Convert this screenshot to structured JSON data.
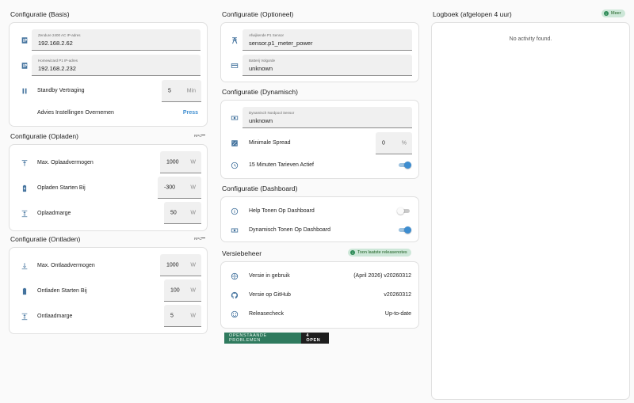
{
  "basis": {
    "title": "Configuratie (Basis)",
    "zendure_caption": "Zendure 2400 AC IP-adres",
    "zendure_value": "192.168.2.62",
    "homewizard_caption": "Homewizard P1 IP-adres",
    "homewizard_value": "192.168.2.232",
    "standby_label": "Standby Vertraging",
    "standby_value": "5",
    "standby_unit": "Min",
    "advies_label": "Advies Instellingen Overnemen",
    "press_label": "Press"
  },
  "opladen": {
    "title": "Configuratie (Opladen)",
    "mini": "RPC",
    "rows": [
      {
        "label": "Max. Oplaadvermogen",
        "value": "1000",
        "unit": "W"
      },
      {
        "label": "Opladen Starten Bij",
        "value": "-300",
        "unit": "W"
      },
      {
        "label": "Oplaadmarge",
        "value": "50",
        "unit": "W"
      }
    ]
  },
  "ontladen": {
    "title": "Configuratie (Ontladen)",
    "mini": "RPC",
    "rows": [
      {
        "label": "Max. Ontlaadvermogen",
        "value": "1000",
        "unit": "W"
      },
      {
        "label": "Ontladen Starten Bij",
        "value": "100",
        "unit": "W"
      },
      {
        "label": "Ontlaadmarge",
        "value": "5",
        "unit": "W"
      }
    ]
  },
  "optioneel": {
    "title": "Configuratie (Optioneel)",
    "sensor_caption": "Afwijkende P1 Sensor",
    "sensor_value": "sensor.p1_meter_power",
    "batterij_caption": "Batterij Volgorde",
    "batterij_value": "unknown"
  },
  "dynamisch": {
    "title": "Configuratie (Dynamisch)",
    "nordpool_caption": "Dynamisch Nordpool Sensor",
    "nordpool_value": "unknown",
    "spread_label": "Minimale Spread",
    "spread_value": "0",
    "spread_unit": "%",
    "kwartier_label": "15 Minuten Tarieven Actief",
    "kwartier_on": true
  },
  "dashboard": {
    "title": "Configuratie (Dashboard)",
    "help_label": "Help Tonen Op Dashboard",
    "help_on": false,
    "dyn_label": "Dynamisch Tonen Op Dashboard",
    "dyn_on": true
  },
  "versie": {
    "title": "Versiebeheer",
    "badge": "Toon laatste releasenotes",
    "rows": [
      {
        "label": "Versie in gebruik",
        "value": "(April 2026) v20260312"
      },
      {
        "label": "Versie op GitHub",
        "value": "v20260312"
      },
      {
        "label": "Releasecheck",
        "value": "Up-to-date"
      }
    ]
  },
  "problemen": {
    "label": "OPENSTAANDE PROBLEMEN",
    "count": "4 OPEN"
  },
  "logboek": {
    "title": "Logboek (afgelopen 4 uur)",
    "meer": "Meer",
    "empty": "No activity found."
  },
  "colors": {
    "accent": "#3d8dd0",
    "icon": "#44739e",
    "badge_bg": "#cde7d8"
  }
}
